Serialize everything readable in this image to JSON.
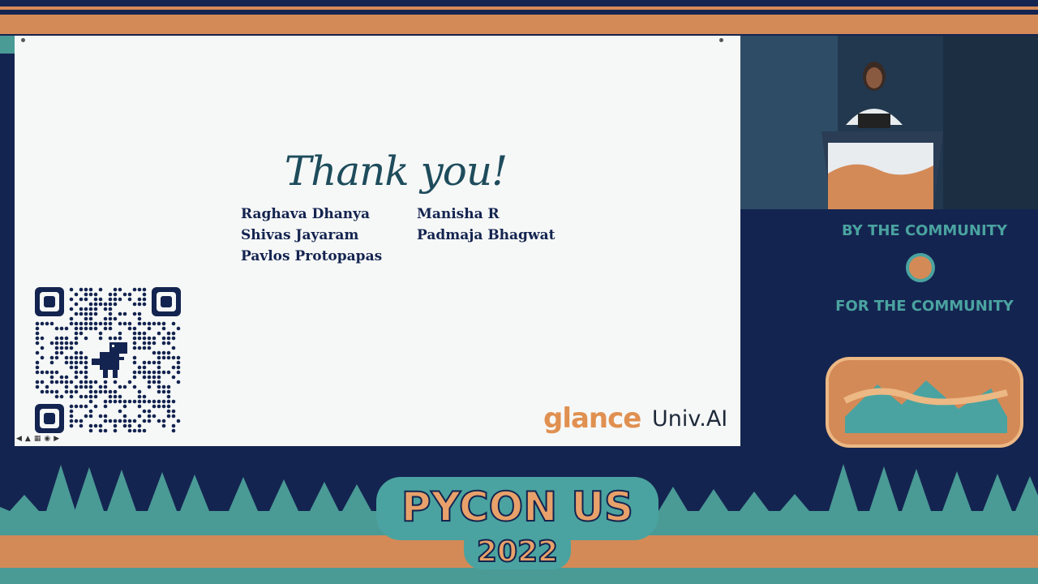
{
  "slide": {
    "title": "Thank you!",
    "names_left": [
      "Raghava Dhanya",
      "Shivas Jayaram",
      "Pavlos Protopapas"
    ],
    "names_right": [
      "Manisha R",
      "Padmaja Bhagwat"
    ],
    "logo_glance": "glance",
    "logo_univ": "Univ.AI",
    "qr_icon": "qr-code-icon"
  },
  "conference": {
    "tagline_top": "BY THE COMMUNITY",
    "tagline_bottom": "FOR THE COMMUNITY",
    "name": "PYCON US",
    "year": "2022"
  },
  "colors": {
    "navy": "#142450",
    "orange": "#d48a57",
    "teal": "#4aa3a0"
  }
}
